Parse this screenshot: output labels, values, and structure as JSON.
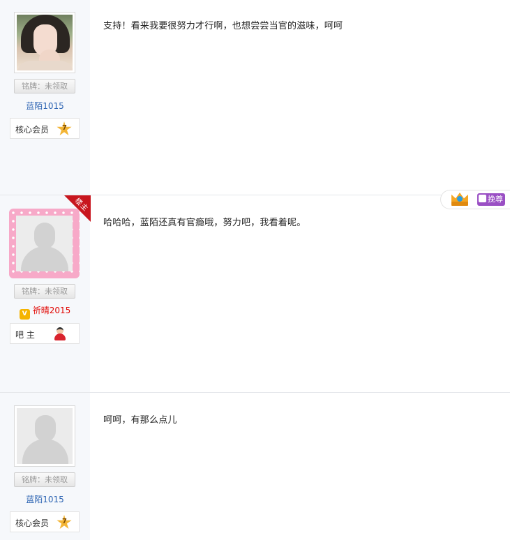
{
  "posts": [
    {
      "medal": "铭牌：未领取",
      "username": "蓝陌1015",
      "level_label": "核心会员",
      "level_number": "7",
      "content": "支持！看来我要很努力才行啊，也想尝尝当官的滋味，呵呵",
      "avatar": "photo"
    },
    {
      "corner_ribbon": "楼主",
      "medal": "铭牌：未领取",
      "username": "祈晴2015",
      "level_label": "吧 主",
      "content": "哈哈哈，蓝陌还真有官瘾哦，努力吧，我看着呢。",
      "avatar": "default-lace-frame",
      "crown_button": "挽尊"
    },
    {
      "medal": "铭牌：未领取",
      "username": "蓝陌1015",
      "level_label": "核心会员",
      "level_number": "7",
      "content": "呵呵，有那么点儿",
      "avatar": "default"
    }
  ],
  "icons": {
    "star": "star-icon",
    "crown": "crown-icon",
    "owner": "owner-icon",
    "vip": "vip-icon"
  },
  "colors": {
    "username_blue": "#2d64b3",
    "username_red": "#e10602",
    "ribbon_red": "#c8161e",
    "crown_button_purple": "#9a4fc4"
  }
}
